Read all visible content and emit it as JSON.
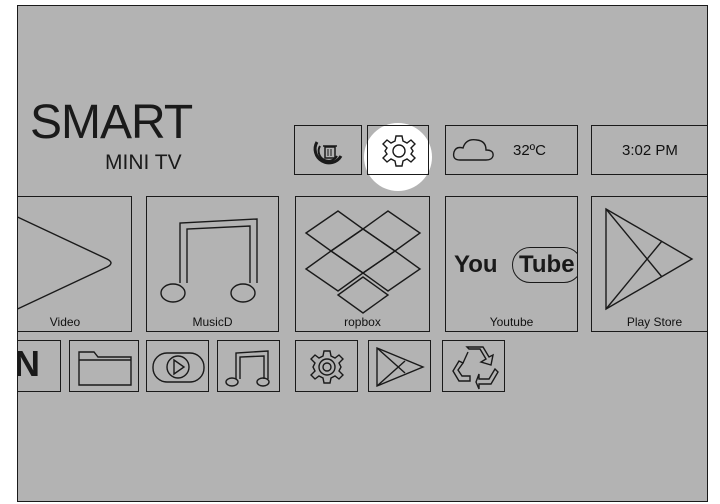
{
  "logo": {
    "smart": "SMART",
    "mini": "MINI TV"
  },
  "status_bar": {
    "cleaner_icon": "trash-cleaner-icon",
    "settings_icon": "gear-icon",
    "weather": {
      "icon": "cloud-icon",
      "temperature": "32ºC"
    },
    "clock": {
      "time": "3:02 PM"
    }
  },
  "apps": [
    {
      "label": "Video",
      "icon": "play-triangle-icon"
    },
    {
      "label": "MusicD",
      "icon": "music-note-icon"
    },
    {
      "label": "ropbox",
      "icon": "dropbox-icon"
    },
    {
      "label": "Youtube",
      "icon": "youtube-logo-icon",
      "logo_you": "You",
      "logo_tube": "Tube"
    },
    {
      "label": "Play Store",
      "icon": "play-store-icon"
    }
  ],
  "dock": {
    "partial_letter": "N",
    "items": [
      "folder-icon",
      "video-player-icon",
      "music-icon",
      "settings-icon",
      "play-store-icon",
      "recycle-icon"
    ]
  },
  "colors": {
    "background": "#b3b3b3",
    "stroke": "#1a1a1a",
    "focus": "#ffffff"
  }
}
